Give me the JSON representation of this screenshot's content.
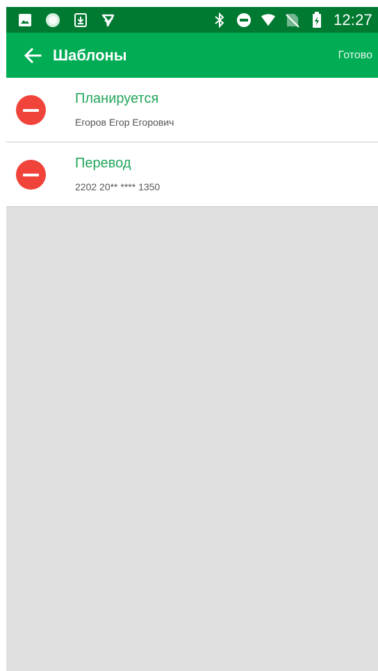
{
  "status_bar": {
    "time": "12:27",
    "left_icons": [
      "gallery-icon",
      "circle-app-icon",
      "download-icon",
      "check-arrow-icon"
    ],
    "right_icons": [
      "bluetooth-icon",
      "do-not-disturb-icon",
      "wifi-icon",
      "no-sim-icon",
      "battery-icon"
    ]
  },
  "app_bar": {
    "title": "Шаблоны",
    "done_label": "Готово",
    "back_icon": "arrow-left-icon"
  },
  "templates": [
    {
      "title": "Планируется",
      "subtitle": "Егоров Егор Егорович"
    },
    {
      "title": "Перевод",
      "subtitle": "2202 20** **** 1350"
    }
  ],
  "colors": {
    "status_bar": "#007a31",
    "app_bar": "#00ad55",
    "item_title": "#22a55a",
    "remove_button": "#f0443b",
    "empty_background": "#e0e0e0"
  }
}
